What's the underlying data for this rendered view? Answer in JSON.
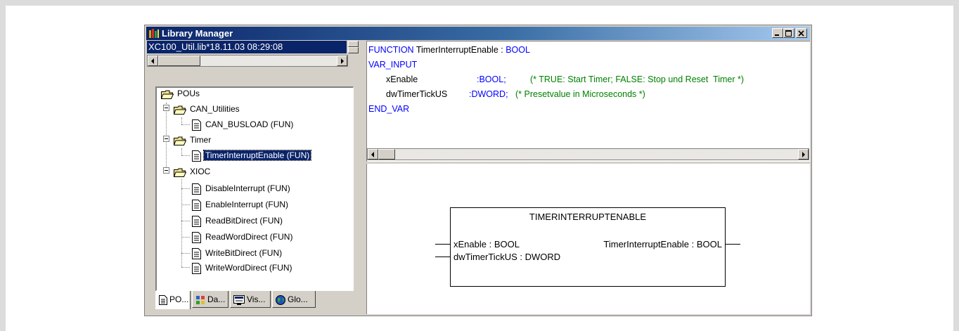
{
  "window": {
    "title": "Library Manager",
    "controls": [
      "minimize",
      "maximize",
      "close"
    ]
  },
  "library_selector": {
    "value": "XC100_Util.lib*18.11.03 08:29:08"
  },
  "tree": {
    "root": "POUs",
    "folders": [
      {
        "label": "CAN_Utilities",
        "items": [
          "CAN_BUSLOAD (FUN)"
        ]
      },
      {
        "label": "Timer",
        "items": [
          "TimerInterruptEnable (FUN)"
        ]
      },
      {
        "label": "XIOC",
        "items": [
          "DisableInterrupt (FUN)",
          "EnableInterrupt (FUN)",
          "ReadBitDirect (FUN)",
          "ReadWordDirect (FUN)",
          "WriteBitDirect (FUN)",
          "WriteWordDirect (FUN)"
        ]
      }
    ],
    "selected": "TimerInterruptEnable (FUN)"
  },
  "tabs": [
    "PO...",
    "Da...",
    "Vis...",
    "Glo..."
  ],
  "declaration": {
    "line1_kw": "FUNCTION",
    "line1_name": " TimerInterruptEnable : ",
    "line1_type": "BOOL",
    "line2": "VAR_INPUT",
    "var1_name": "xEnable",
    "var1_type": ":BOOL;",
    "var1_comment": "(* TRUE: Start Timer; FALSE: Stop und Reset  Timer *)",
    "var2_name": "dwTimerTickUS",
    "var2_type": ":DWORD;",
    "var2_comment": "(* Presetvalue in Microseconds *)",
    "line_end": "END_VAR"
  },
  "function_block": {
    "name": "TIMERINTERRUPTENABLE",
    "input1": "xEnable : BOOL",
    "input2": "dwTimerTickUS : DWORD",
    "output1": "TimerInterruptEnable : BOOL"
  },
  "colors": {
    "keyword": "#0000ff",
    "comment": "#008000",
    "selection": "#0a246a",
    "titlebar_start": "#0a246a",
    "titlebar_end": "#a6caf0"
  }
}
